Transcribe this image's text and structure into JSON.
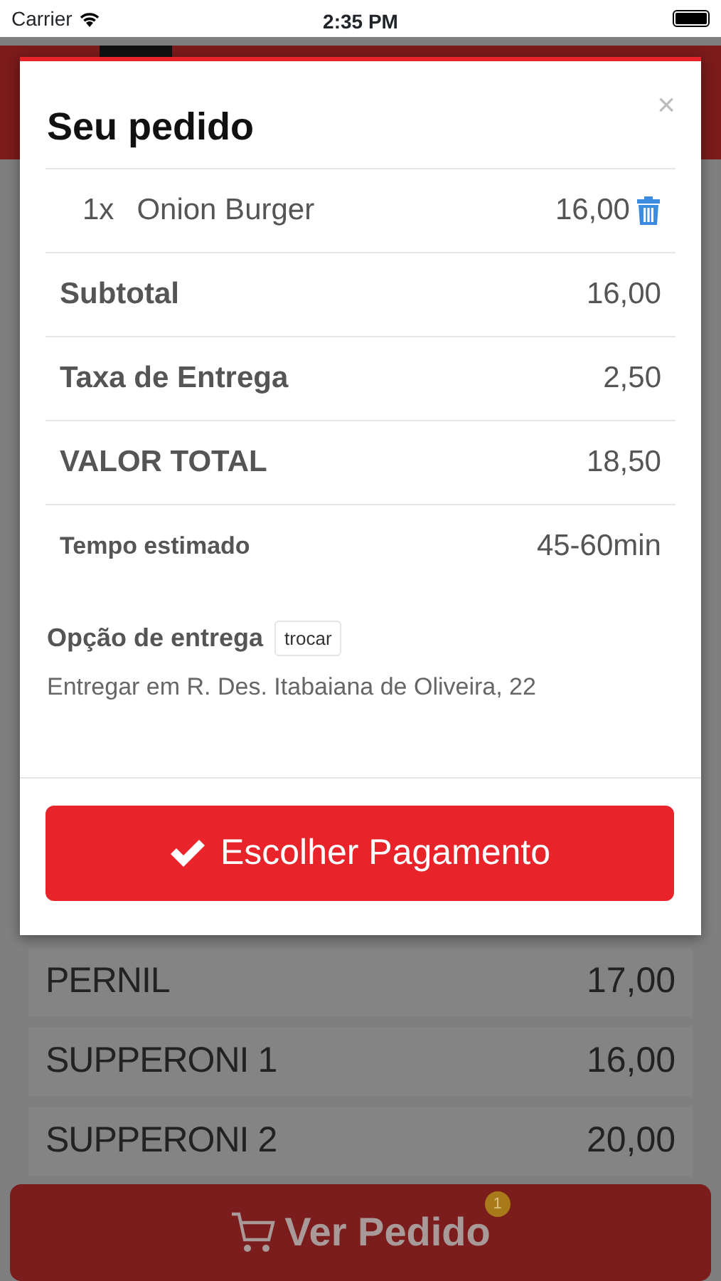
{
  "status_bar": {
    "carrier": "Carrier",
    "time": "2:35 PM"
  },
  "menu_items": [
    {
      "name": "PERNIL",
      "price": "17,00"
    },
    {
      "name": "SUPPERONI 1",
      "price": "16,00"
    },
    {
      "name": "SUPPERONI 2",
      "price": "20,00"
    }
  ],
  "cart_button": {
    "label": "Ver Pedido",
    "badge": "1"
  },
  "modal": {
    "title": "Seu pedido",
    "close": "×",
    "items": [
      {
        "quantity": "1x",
        "name": "Onion Burger",
        "price": "16,00"
      }
    ],
    "summary": [
      {
        "label": "Subtotal",
        "value": "16,00",
        "kind": "amount"
      },
      {
        "label": "Taxa de Entrega",
        "value": "2,50",
        "kind": "amount"
      },
      {
        "label": "VALOR TOTAL",
        "value": "18,50",
        "kind": "amount"
      },
      {
        "label": "Tempo estimado",
        "value": "45-60min",
        "kind": "time"
      }
    ],
    "delivery": {
      "label": "Opção de entrega",
      "change_button": "trocar",
      "address": "Entregar em R. Des. Itabaiana de Oliveira, 22"
    },
    "submit_button": "Escolher Pagamento"
  }
}
